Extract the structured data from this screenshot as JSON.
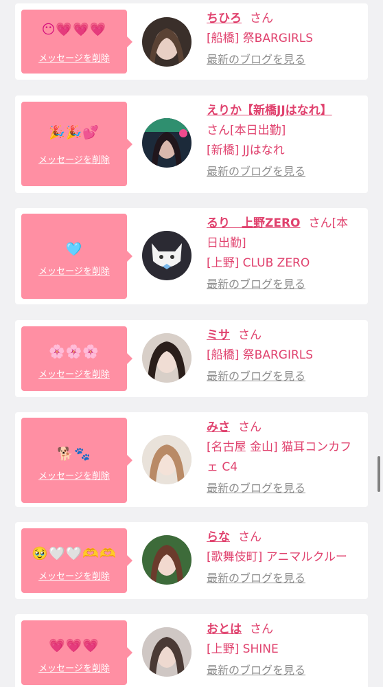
{
  "favorites": [
    {
      "message": "😶💗💗💗",
      "delete_label": "メッセージを削除",
      "name": "ちひろ",
      "suffix": "さん",
      "line2": "[船橋] 祭BARGIRLS",
      "line3": "",
      "blog_link": "最新のブログを見る"
    },
    {
      "message": "🎉🎉💕",
      "delete_label": "メッセージを削除",
      "name": "えりか【新橋JJはなれ】",
      "suffix": "",
      "line2": "さん[本日出勤]",
      "line3": "[新橋] JJはなれ",
      "blog_link": "最新のブログを見る"
    },
    {
      "message": "🩵",
      "delete_label": "メッセージを削除",
      "name": "るり　上野ZERO",
      "suffix": "さん[本",
      "line2": "日出勤]",
      "line3": "[上野] CLUB ZERO",
      "blog_link": "最新のブログを見る"
    },
    {
      "message": "🌸🌸🌸",
      "delete_label": "メッセージを削除",
      "name": "ミサ",
      "suffix": "さん",
      "line2": "[船橋] 祭BARGIRLS",
      "line3": "",
      "blog_link": "最新のブログを見る"
    },
    {
      "message": "🐕🐾",
      "delete_label": "メッセージを削除",
      "name": "みさ",
      "suffix": "さん",
      "line2": "[名古屋 金山] 猫耳コンカフ",
      "line3": "ェ C4",
      "blog_link": "最新のブログを見る"
    },
    {
      "message": "🥹🤍🤍🫶🫶",
      "delete_label": "メッセージを削除",
      "name": "らな",
      "suffix": "さん",
      "line2": "[歌舞伎町] アニマルクルー",
      "line3": "",
      "blog_link": "最新のブログを見る"
    },
    {
      "message": "💗💗💗",
      "delete_label": "メッセージを削除",
      "name": "おとは",
      "suffix": "さん",
      "line2": "[上野] SHINE",
      "line3": "",
      "blog_link": "最新のブログを見る"
    }
  ],
  "colors": {
    "accent": "#e0426e",
    "bubble": "#ff8fa3",
    "link_gray": "#8c8c8c",
    "background": "#f1f1f3",
    "card": "#ffffff"
  }
}
